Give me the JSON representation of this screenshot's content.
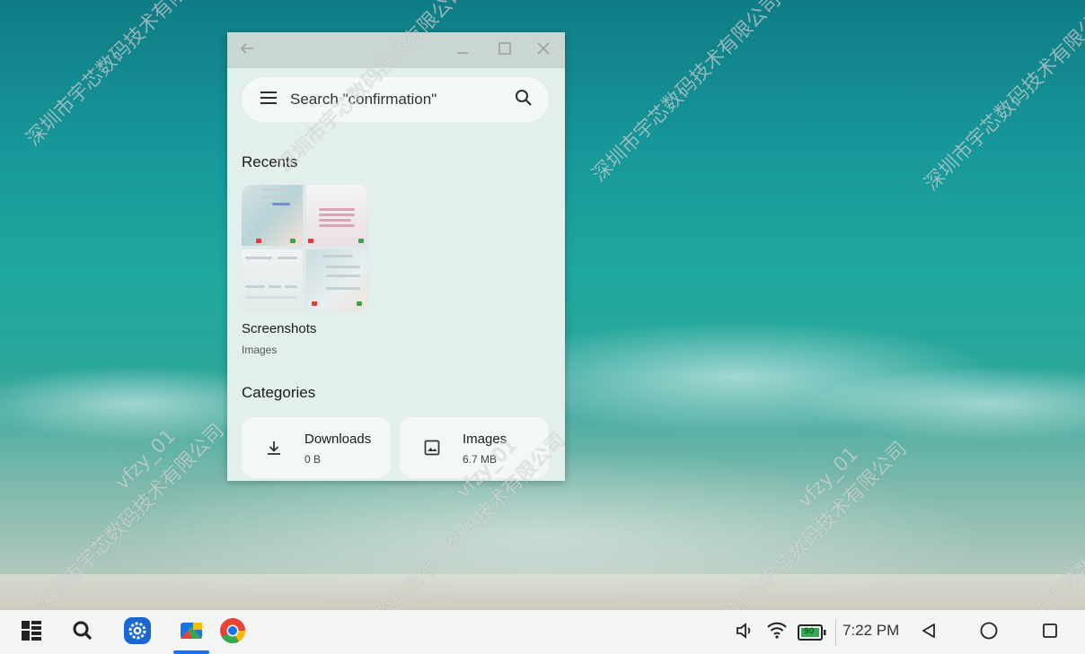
{
  "window": {
    "search_text": "Search \"confirmation\"",
    "recents_title": "Recents",
    "album": {
      "name": "Screenshots",
      "type": "Images"
    },
    "categories_title": "Categories",
    "categories": [
      {
        "name": "Downloads",
        "size": "0 B",
        "icon": "download-icon"
      },
      {
        "name": "Images",
        "size": "6.7 MB",
        "icon": "image-icon"
      }
    ]
  },
  "taskbar": {
    "apps": [
      "app-drawer-icon",
      "search-icon",
      "settings-icon",
      "files-icon",
      "chrome-icon"
    ],
    "time": "7:22 PM",
    "battery_text": "90",
    "colors": {
      "accent": "#1a73e8",
      "settings": "#1967d2",
      "battery": "#34a853"
    }
  },
  "watermark": {
    "text_a": "深圳市宇芯数码技术有限公司",
    "text_b": "vfzy_01"
  }
}
